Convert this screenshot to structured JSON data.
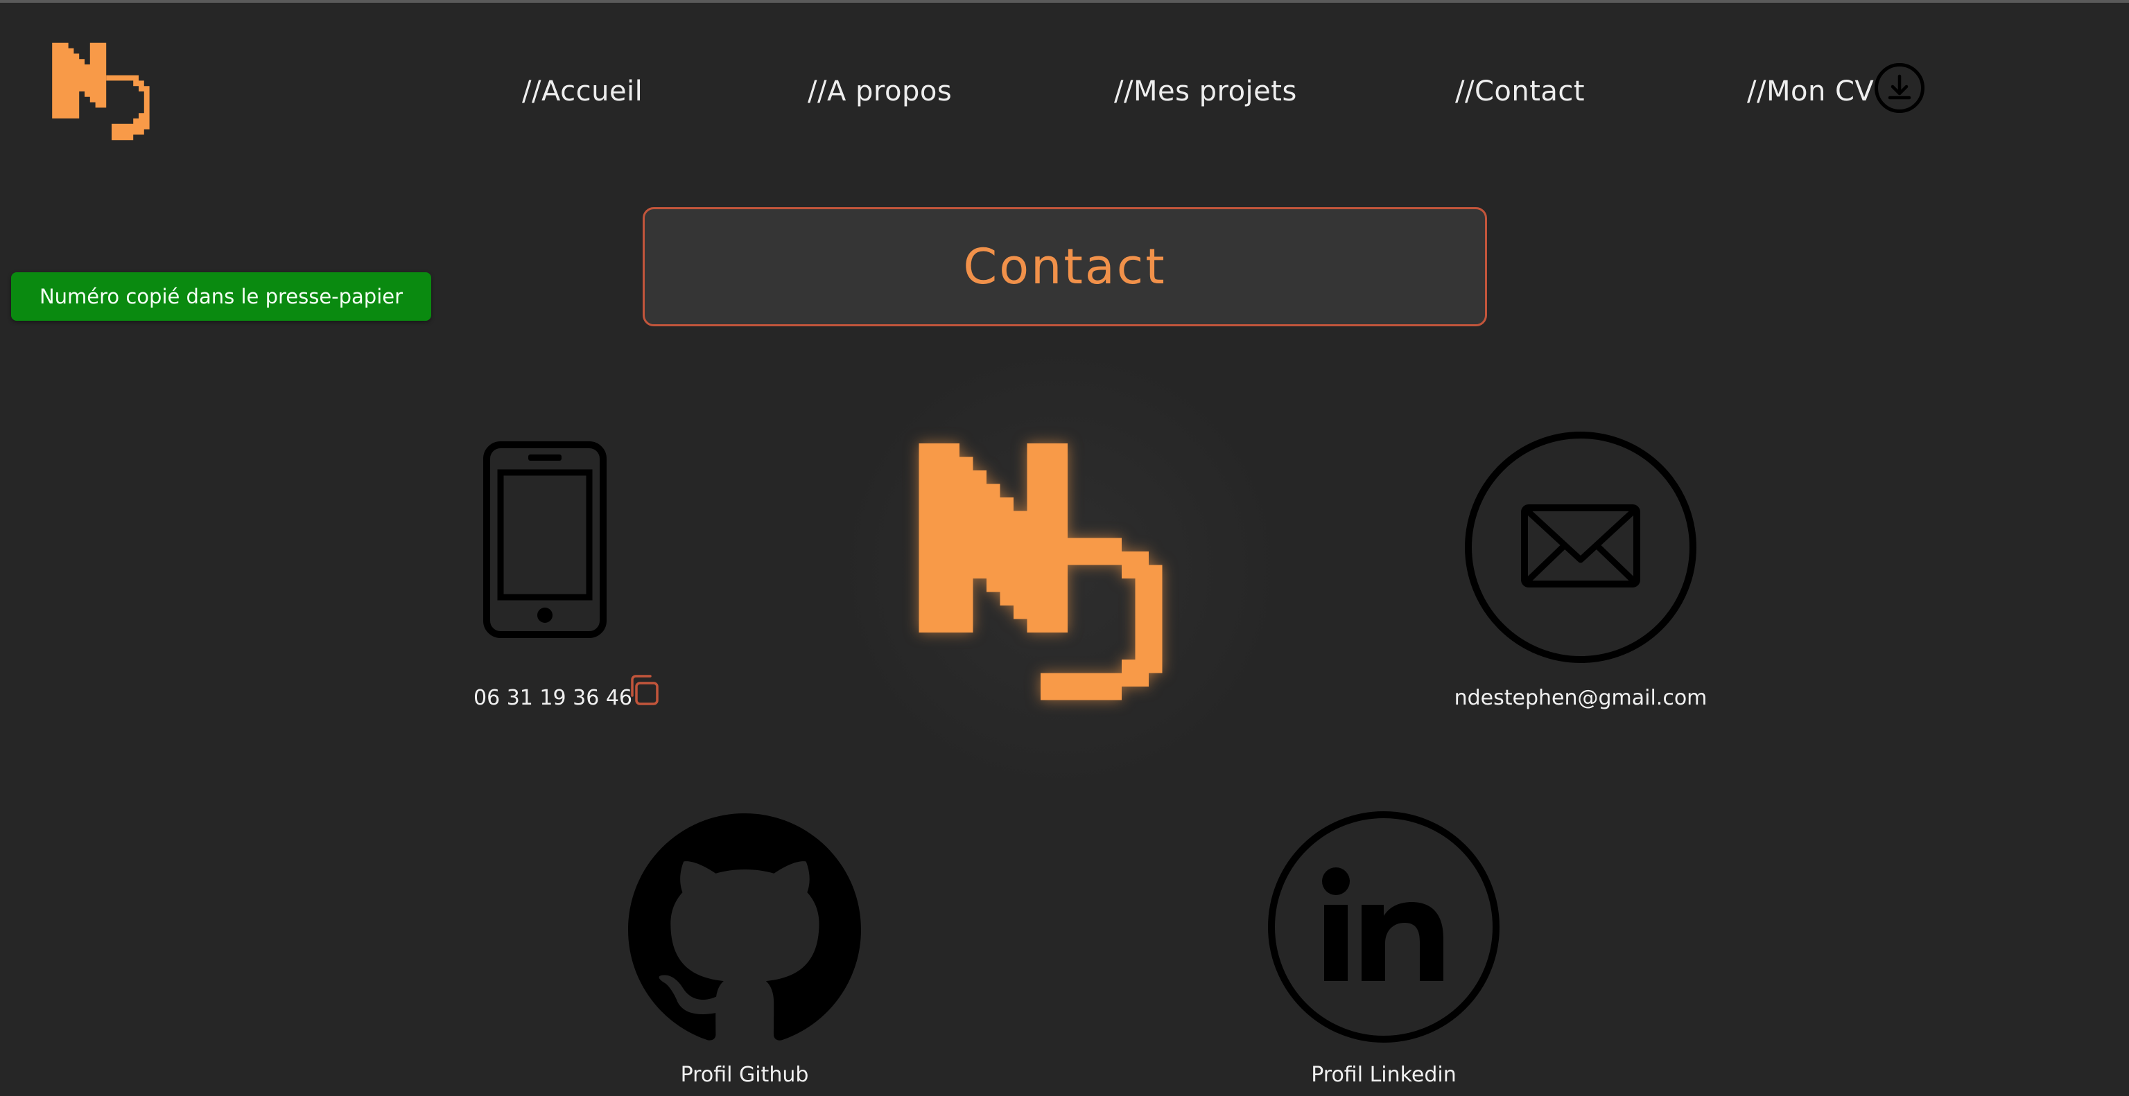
{
  "nav": {
    "items": [
      {
        "label": "//Accueil"
      },
      {
        "label": "//A propos"
      },
      {
        "label": "//Mes projets"
      },
      {
        "label": "//Contact"
      },
      {
        "label": "//Mon CV"
      }
    ]
  },
  "toast": {
    "message": "Numéro copié dans le presse-papier"
  },
  "page": {
    "title": "Contact"
  },
  "contacts": {
    "phone": {
      "number": "06 31 19 36 46"
    },
    "email": {
      "address": "ndestephen@gmail.com"
    },
    "github": {
      "label": "Profil Github"
    },
    "linkedin": {
      "label": "Profil Linkedin"
    }
  },
  "colors": {
    "background": "#262626",
    "accent_orange": "#f89a48",
    "title_border": "#c2553b",
    "toast_green": "#0a8a10"
  },
  "icons": [
    "logo-nd",
    "download-icon",
    "phone-icon",
    "copy-icon",
    "mail-icon",
    "github-icon",
    "linkedin-icon"
  ]
}
